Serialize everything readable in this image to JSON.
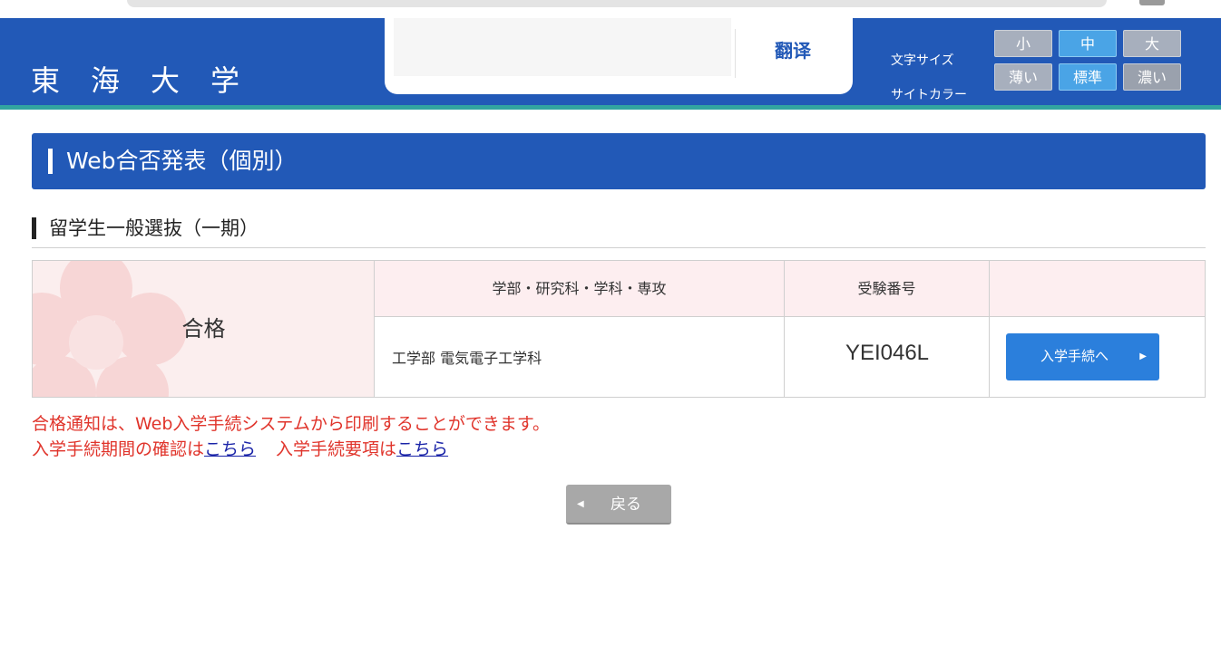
{
  "header": {
    "site_title": "東海大学",
    "translate_label": "翻译",
    "text_size_label": "文字サイズ",
    "site_color_label": "サイトカラー",
    "text_sizes": [
      "小",
      "中",
      "大"
    ],
    "site_colors": [
      "薄い",
      "標準",
      "濃い"
    ],
    "active_text_size": "中",
    "active_site_color": "標準"
  },
  "page": {
    "section_title": "Web合否発表（個別）",
    "sub_title": "留学生一般選抜（一期）"
  },
  "result": {
    "status": "合格",
    "columns": [
      "学部・研究科・学科・専攻",
      "受験番号",
      ""
    ],
    "department": "工学部 電気電子工学科",
    "exam_number": "YEI046L",
    "procedure_button": "入学手続へ"
  },
  "notice": {
    "line1": "合格通知は、Web入学手続システムから印刷することができます。",
    "period_text": "入学手続期間の確認は",
    "period_link": "こちら",
    "guide_text": "入学手続要項は",
    "guide_link": "こちら"
  },
  "back_button": "戻る",
  "colors": {
    "header_blue": "#2259b7",
    "accent_teal": "#32a4a0",
    "notice_red": "#e0342b",
    "pass_pink": "#fbeeee",
    "button_blue": "#2b7fdc"
  }
}
